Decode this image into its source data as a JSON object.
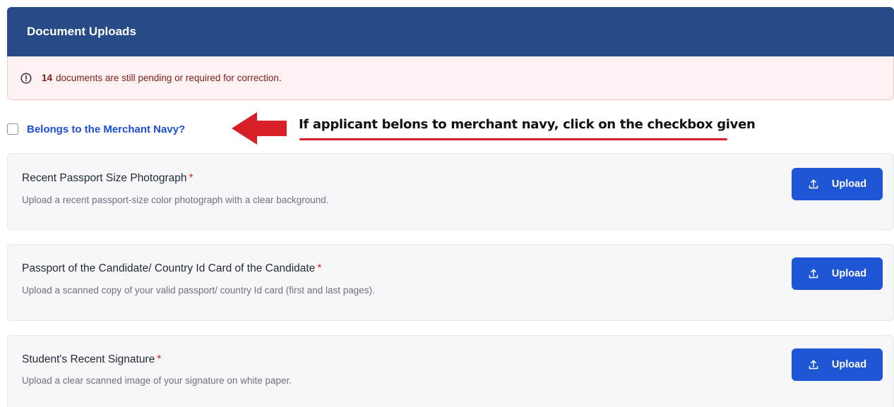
{
  "header": {
    "title": "Document Uploads"
  },
  "alert": {
    "count": "14",
    "message": "documents are still pending or required for correction."
  },
  "merchant_navy": {
    "label": "Belongs to the Merchant Navy?",
    "checked": false
  },
  "annotation": {
    "text": "If applicant belons to merchant navy, click on the checkbox given",
    "color": "#d61f26"
  },
  "documents": [
    {
      "title": "Recent Passport Size Photograph",
      "required_mark": "*",
      "description": "Upload a recent passport-size color photograph with a clear background.",
      "button_label": "Upload"
    },
    {
      "title": "Passport of the Candidate/ Country Id Card of the Candidate",
      "required_mark": "*",
      "description": "Upload a scanned copy of your valid passport/ country Id card (first and last pages).",
      "button_label": "Upload"
    },
    {
      "title": "Student's Recent Signature",
      "required_mark": "*",
      "description": "Upload a clear scanned image of your signature on white paper.",
      "button_label": "Upload"
    }
  ],
  "colors": {
    "header_bg": "#264b87",
    "primary_button": "#1f56d6",
    "alert_bg": "#fdf1f1",
    "link": "#1d4ed8",
    "required": "#dc2626"
  },
  "icons": {
    "alert": "info-circle-icon",
    "upload": "upload-icon",
    "annotation": "red-arrow-left-icon"
  }
}
